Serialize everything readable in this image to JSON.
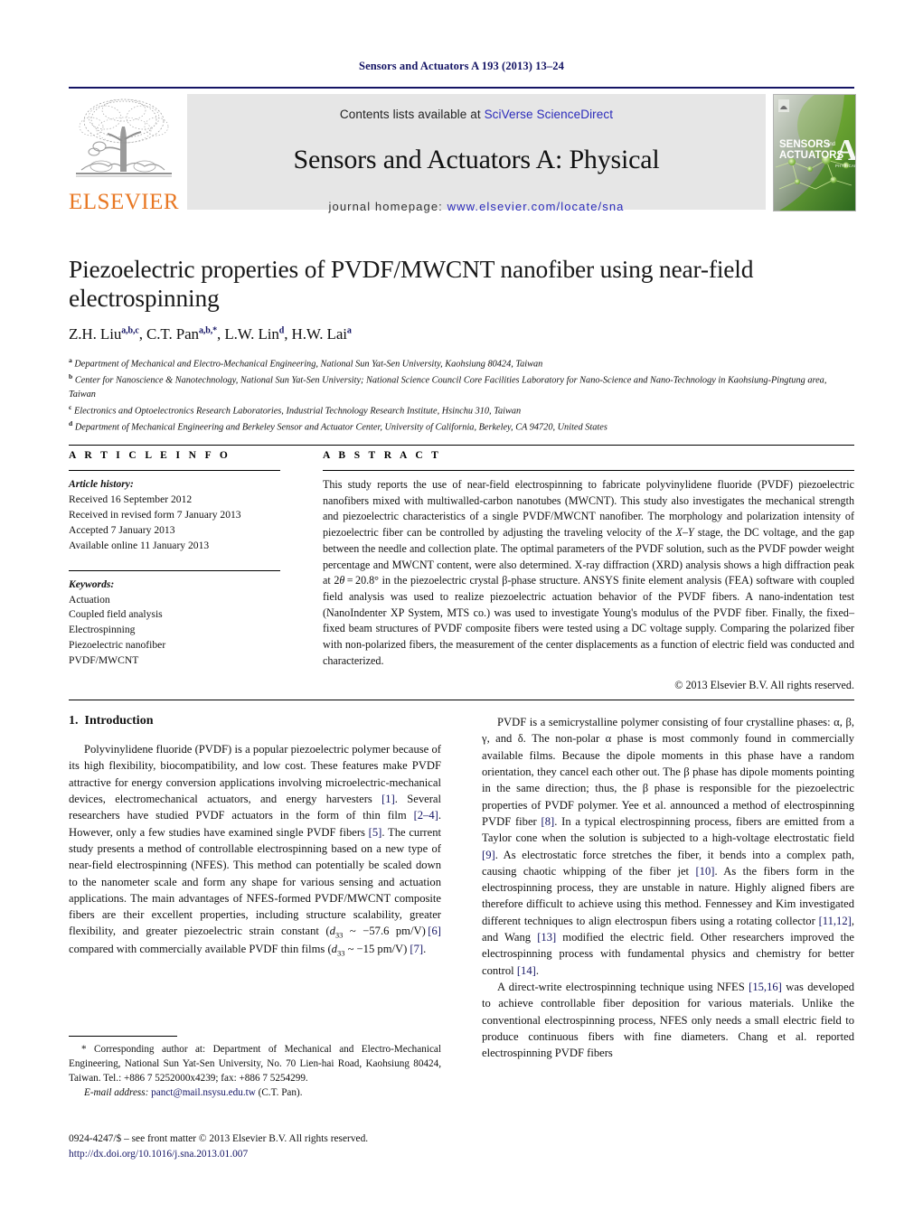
{
  "running_head": "Sensors and Actuators A 193 (2013) 13–24",
  "masthead": {
    "contents_prefix": "Contents lists available at ",
    "sciencedirect_link": "SciVerse ScienceDirect",
    "journal_title": "Sensors and Actuators A: Physical",
    "homepage_prefix": "journal homepage: ",
    "homepage_url": "www.elsevier.com/locate/sna",
    "publisher_wordmark": "ELSEVIER",
    "publisher_logo_icon": "elsevier-tree-logo",
    "cover_title_line1": "SENSORS and",
    "cover_title_line2": "ACTUATORS",
    "cover_letter": "A",
    "cover_sub": "PHYSICAL",
    "link_color": "#2b2bbb",
    "band_color": "#e6e6e6",
    "rule_color": "#141464",
    "elsevier_orange": "#E87722"
  },
  "article": {
    "title": "Piezoelectric properties of PVDF/MWCNT nanofiber using near-field electrospinning",
    "authors_html": "Z.H. Liu<sup>a,b,c</sup>, C.T. Pan<sup>a,b,</sup><sup>*</sup>, L.W. Lin<sup>d</sup>, H.W. Lai<sup>a</sup>",
    "affiliations": [
      {
        "marker": "a",
        "text": "Department of Mechanical and Electro-Mechanical Engineering, National Sun Yat-Sen University, Kaohsiung 80424, Taiwan"
      },
      {
        "marker": "b",
        "text": "Center for Nanoscience & Nanotechnology, National Sun Yat-Sen University; National Science Council Core Facilities Laboratory for Nano-Science and Nano-Technology in Kaohsiung-Pingtung area, Taiwan"
      },
      {
        "marker": "c",
        "text": "Electronics and Optoelectronics Research Laboratories, Industrial Technology Research Institute, Hsinchu 310, Taiwan"
      },
      {
        "marker": "d",
        "text": "Department of Mechanical Engineering and Berkeley Sensor and Actuator Center, University of California, Berkeley, CA 94720, United States"
      }
    ]
  },
  "article_info": {
    "heading": "A R T I C L E   I N F O",
    "history_label": "Article history:",
    "history": [
      "Received 16 September 2012",
      "Received in revised form 7 January 2013",
      "Accepted 7 January 2013",
      "Available online 11 January 2013"
    ],
    "keywords_label": "Keywords:",
    "keywords": [
      "Actuation",
      "Coupled field analysis",
      "Electrospinning",
      "Piezoelectric nanofiber",
      "PVDF/MWCNT"
    ]
  },
  "abstract": {
    "heading": "A B S T R A C T",
    "body_html": "This study reports the use of near-field electrospinning to fabricate polyvinylidene fluoride (PVDF) piezoelectric nanofibers mixed with multiwalled-carbon nanotubes (MWCNT). This study also investigates the mechanical strength and piezoelectric characteristics of a single PVDF/MWCNT nanofiber. The morphology and polarization intensity of piezoelectric fiber can be controlled by adjusting the traveling velocity of the <span class=\"ital\">X&ndash;Y</span> stage, the DC voltage, and the gap between the needle and collection plate. The optimal parameters of the PVDF solution, such as the PVDF powder weight percentage and MWCNT content, were also determined. X-ray diffraction (XRD) analysis shows a high diffraction peak at 2<span class=\"ital\">&theta;</span>&thinsp;=&thinsp;20.8&deg; in the piezoelectric crystal &beta;-phase structure. ANSYS finite element analysis (FEA) software with coupled field analysis was used to realize piezoelectric actuation behavior of the PVDF fibers. A nano-indentation test (NanoIndenter XP System, MTS co.) was used to investigate Young's modulus of the PVDF fiber. Finally, the fixed&ndash;fixed beam structures of PVDF composite fibers were tested using a DC voltage supply. Comparing the polarized fiber with non-polarized fibers, the measurement of the center displacements as a function of electric field was conducted and characterized.",
    "copyright": "© 2013 Elsevier B.V. All rights reserved."
  },
  "introduction": {
    "number": "1.",
    "title": "Introduction",
    "left_paragraphs_html": [
      "Polyvinylidene fluoride (PVDF) is a popular piezoelectric polymer because of its high flexibility, biocompatibility, and low cost. These features make PVDF attractive for energy conversion applications involving microelectric-mechanical devices, electromechanical actuators, and energy harvesters <span class=\"ref\">[1]</span>. Several researchers have studied PVDF actuators in the form of thin film <span class=\"ref\">[2&ndash;4]</span>. However, only a few studies have examined single PVDF fibers <span class=\"ref\">[5]</span>. The current study presents a method of controllable electrospinning based on a new type of near-field electrospinning (NFES). This method can potentially be scaled down to the nanometer scale and form any shape for various sensing and actuation applications. The main advantages of NFES-formed PVDF/MWCNT composite fibers are their excellent properties, including structure scalability, greater flexibility, and greater piezoelectric strain constant (<span class=\"ital\">d</span><sub>33</sub> ~ &minus;57.6 pm/V)&thinsp;<span class=\"ref\">[6]</span> compared with commercially available PVDF thin films (<span class=\"ital\">d</span><sub>33</sub> ~ &minus;15 pm/V) <span class=\"ref\">[7]</span>."
    ],
    "right_paragraphs_html": [
      "PVDF is a semicrystalline polymer consisting of four crystalline phases: &alpha;, &beta;, &gamma;, and &delta;. The non-polar &alpha; phase is most commonly found in commercially available films. Because the dipole moments in this phase have a random orientation, they cancel each other out. The &beta; phase has dipole moments pointing in the same direction; thus, the &beta; phase is responsible for the piezoelectric properties of PVDF polymer. Yee et al. announced a method of electrospinning PVDF fiber <span class=\"ref\">[8]</span>. In a typical electrospinning process, fibers are emitted from a Taylor cone when the solution is subjected to a high-voltage electrostatic field <span class=\"ref\">[9]</span>. As electrostatic force stretches the fiber, it bends into a complex path, causing chaotic whipping of the fiber jet <span class=\"ref\">[10]</span>. As the fibers form in the electrospinning process, they are unstable in nature. Highly aligned fibers are therefore difficult to achieve using this method. Fennessey and Kim investigated different techniques to align electrospun fibers using a rotating collector <span class=\"ref\">[11,12]</span>, and Wang <span class=\"ref\">[13]</span> modified the electric field. Other researchers improved the electrospinning process with fundamental physics and chemistry for better control <span class=\"ref\">[14]</span>.",
      "A direct-write electrospinning technique using NFES <span class=\"ref\">[15,16]</span> was developed to achieve controllable fiber deposition for various materials. Unlike the conventional electrospinning process, NFES only needs a small electric field to produce continuous fibers with fine diameters. Chang et al. reported electrospinning PVDF fibers"
    ]
  },
  "footnotes": {
    "corresponding_html": "* Corresponding author at: Department of Mechanical and Electro-Mechanical Engineering, National Sun Yat-Sen University, No. 70 Lien-hai Road, Kaohsiung 80424, Taiwan. Tel.: +886 7 5252000x4239; fax: +886 7 5254299.",
    "email_label": "E-mail address:",
    "email_address": "panct@mail.nsysu.edu.tw",
    "email_owner": "(C.T. Pan).",
    "imprint_line": "0924-4247/$ – see front matter © 2013 Elsevier B.V. All rights reserved.",
    "doi_url": "http://dx.doi.org/10.1016/j.sna.2013.01.007"
  }
}
